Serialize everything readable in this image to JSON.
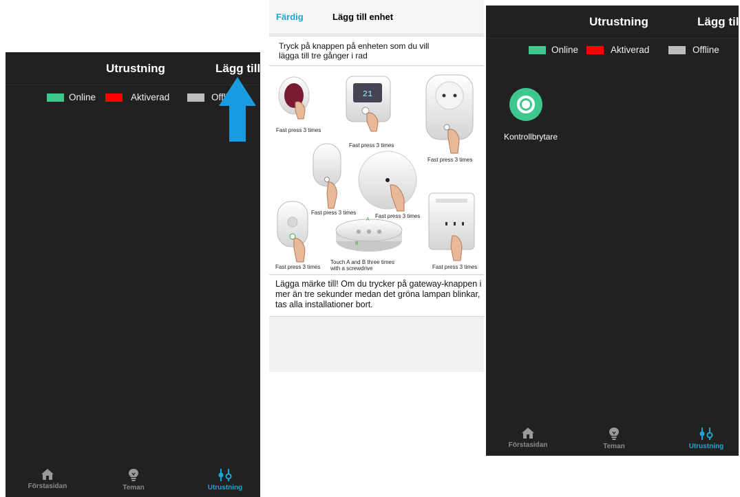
{
  "colors": {
    "online": "#3ec88d",
    "activated": "#ff0000",
    "offline": "#bdbdbd",
    "accent": "#1aa6d9",
    "background": "#212121"
  },
  "screen_left": {
    "title": "Utrustning",
    "add_label": "Lägg till",
    "legend": {
      "online": "Online",
      "activated": "Aktiverad",
      "offline": "Offline"
    },
    "tabs": [
      {
        "label": "Förstasidan",
        "icon": "home-icon"
      },
      {
        "label": "Teman",
        "icon": "lightbulb-icon"
      },
      {
        "label": "Utrustning",
        "icon": "sliders-icon"
      }
    ]
  },
  "screen_middle": {
    "done_label": "Färdig",
    "title": "Lägg till enhet",
    "instruction": "Tryck på knappen på enheten som du vill lägga till tre gånger i rad",
    "captions": {
      "fast_press": "Fast press 3 times",
      "touch_ab_line1": "Touch A and B three times",
      "touch_ab_line2": "with a screwdrive"
    },
    "marker_a": "A",
    "marker_b": "B",
    "note": "Lägga märke till! Om du trycker på gateway-knappen i mer än tre sekunder medan det gröna lampan blinkar, tas alla installationer bort."
  },
  "screen_right": {
    "title": "Utrustning",
    "add_label": "Lägg till",
    "legend": {
      "online": "Online",
      "activated": "Aktiverad",
      "offline": "Offline"
    },
    "device": {
      "name": "Kontrollbrytare",
      "icon": "switch-icon",
      "status": "online"
    },
    "tabs": [
      {
        "label": "Förstasidan",
        "icon": "home-icon"
      },
      {
        "label": "Teman",
        "icon": "lightbulb-icon"
      },
      {
        "label": "Utrustning",
        "icon": "sliders-icon"
      }
    ]
  }
}
